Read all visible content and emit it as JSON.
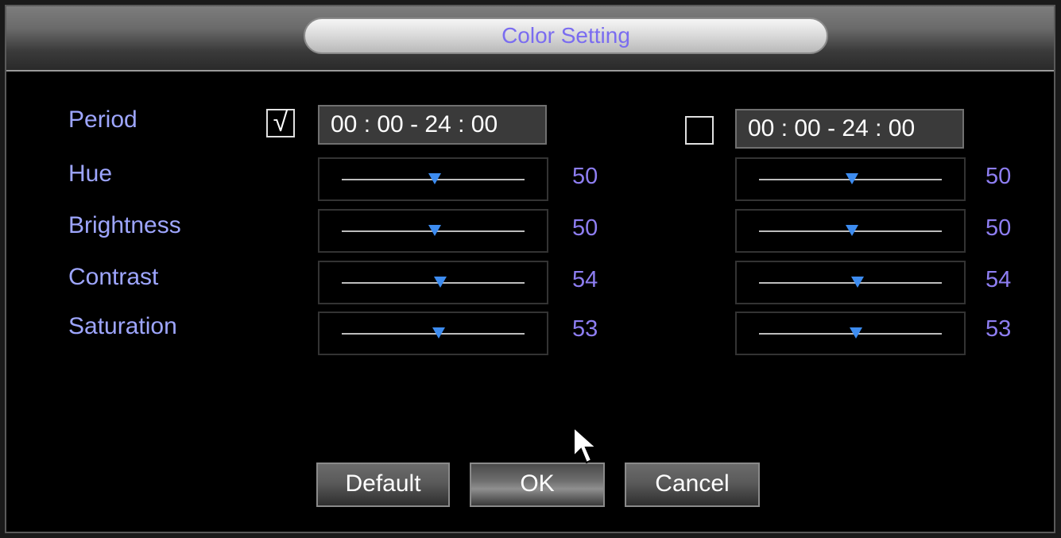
{
  "title": "Color Setting",
  "rows": {
    "period": "Period",
    "hue": "Hue",
    "brightness": "Brightness",
    "contrast": "Contrast",
    "saturation": "Saturation"
  },
  "period1": {
    "checked": true,
    "check_glyph": "√",
    "time": "00 : 00 - 24 : 00"
  },
  "period2": {
    "checked": false,
    "check_glyph": "",
    "time": "00 : 00 - 24 : 00"
  },
  "values1": {
    "hue": "50",
    "brightness": "50",
    "contrast": "54",
    "saturation": "53"
  },
  "values2": {
    "hue": "50",
    "brightness": "50",
    "contrast": "54",
    "saturation": "53"
  },
  "buttons": {
    "default": "Default",
    "ok": "OK",
    "cancel": "Cancel"
  },
  "colors": {
    "label": "#9ea6ff",
    "value": "#8e7ef2",
    "title": "#7a6cf0",
    "slider_thumb": "#3d8cf0"
  }
}
